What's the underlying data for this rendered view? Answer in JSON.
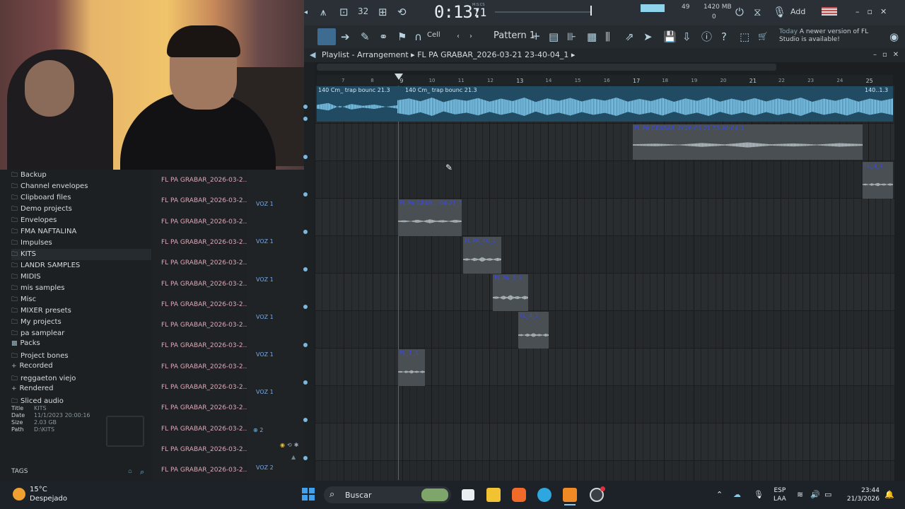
{
  "transport": {
    "time_main": "0:13:",
    "time_ms": "71",
    "time_label": "M:S:CS",
    "tempo": "32",
    "cpu_value": "49",
    "memory": "1420 MB",
    "memory_sub": "0",
    "add_label": "Add"
  },
  "toolbar": {
    "snap_label": "Cell",
    "pattern_label": "Pattern 1",
    "update_prefix": "Today",
    "update_text": "A newer version of FL Studio is available!"
  },
  "playlist": {
    "title": "Playlist - Arrangement",
    "arrangement": "FL PA GRABAR_2026-03-21 23-40-04_1",
    "bar_numbers": [
      "7",
      "8",
      "9",
      "10",
      "11",
      "12",
      "13",
      "14",
      "15",
      "16",
      "17",
      "18",
      "19",
      "20",
      "21",
      "22",
      "23",
      "24",
      "25"
    ],
    "clips": {
      "main_title_a": "140 Cm_ trap bounc 21.3",
      "main_title_b": "140 Cm_ trap bounc 21.3",
      "main_title_c": "140..1.3",
      "rec_title": "FL PA GRABAR_2026-03-21 23-40-04_1",
      "clip3_title": "FL_4_1",
      "voz_a": "FL PA GRAB...-04-21_1",
      "voz_b": "FL PA_40_1",
      "voz_c": "FL PA_3_1",
      "voz_d": "FL_4_1",
      "voz_e": "FL_1_1"
    }
  },
  "browser": {
    "items": [
      {
        "icon": "folder-icon",
        "label": "Backup"
      },
      {
        "icon": "folder-icon",
        "label": "Channel envelopes"
      },
      {
        "icon": "folder-icon",
        "label": "Clipboard files"
      },
      {
        "icon": "folder-icon",
        "label": "Demo projects"
      },
      {
        "icon": "folder-icon",
        "label": "Envelopes"
      },
      {
        "icon": "folder-icon",
        "label": "FMA NAFTALINA"
      },
      {
        "icon": "folder-icon",
        "label": "Impulses"
      },
      {
        "icon": "folder-icon",
        "label": "KITS"
      },
      {
        "icon": "folder-icon",
        "label": "LANDR SAMPLES"
      },
      {
        "icon": "folder-icon",
        "label": "MIDIS"
      },
      {
        "icon": "folder-icon",
        "label": "mis samples"
      },
      {
        "icon": "folder-icon",
        "label": "Misc"
      },
      {
        "icon": "folder-icon",
        "label": "MIXER presets"
      },
      {
        "icon": "folder-icon",
        "label": "My projects"
      },
      {
        "icon": "folder-icon",
        "label": "pa samplear"
      },
      {
        "icon": "packs-icon",
        "label": "Packs"
      },
      {
        "icon": "folder-icon",
        "label": "Project bones"
      },
      {
        "icon": "plus-icon",
        "label": "Recorded"
      },
      {
        "icon": "folder-icon",
        "label": "reggaeton viejo"
      },
      {
        "icon": "plus-icon",
        "label": "Rendered"
      },
      {
        "icon": "folder-icon",
        "label": "Sliced audio"
      }
    ],
    "info": {
      "title_key": "Title",
      "title_val": "KITS",
      "date_key": "Date",
      "date_val": "11/1/2023 20:00:16",
      "size_key": "Size",
      "size_val": "2.03 GB",
      "path_key": "Path",
      "path_val": "D:\\KITS"
    },
    "tags_label": "TAGS"
  },
  "patterns": [
    "FL PA GRABAR_2026-03-2...",
    "FL PA GRABAR_2026-03-2...",
    "FL PA GRABAR_2026-03-2...",
    "FL PA GRABAR_2026-03-2...",
    "FL PA GRABAR_2026-03-2...",
    "FL PA GRABAR_2026-03-2...",
    "FL PA GRABAR_2026-03-2...",
    "FL PA GRABAR_2026-03-2...",
    "FL PA GRABAR_2026-03-2...",
    "FL PA GRABAR_2026-03-2...",
    "FL PA GRABAR_2026-03-2...",
    "FL PA GRABAR_2026-03-2...",
    "FL PA GRABAR_2026-03-2...",
    "FL PA GRABAR_2026-03-2...",
    "FL PA GRABAR_2026-03-2..."
  ],
  "tracks": {
    "voz1": "VOZ 1",
    "voz2": "VOZ 2",
    "group_num": "2"
  },
  "taskbar": {
    "temp": "15°C",
    "weather": "Despejado",
    "search_placeholder": "Buscar",
    "lang_top": "ESP",
    "lang_bottom": "LAA",
    "time": "23:44",
    "date": "21/3/2026"
  }
}
